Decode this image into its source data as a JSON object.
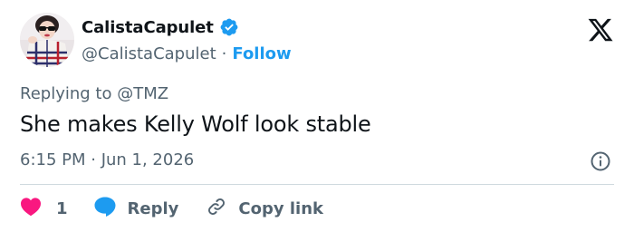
{
  "author": {
    "display_name": "CalistaCapulet",
    "handle": "@CalistaCapulet",
    "separator": "·",
    "follow_label": "Follow"
  },
  "tweet": {
    "replying_to": "Replying to @TMZ",
    "text": "She makes Kelly Wolf look stable",
    "timestamp": "6:15 PM · Jun 1, 2026"
  },
  "actions": {
    "like_count": "1",
    "reply_label": "Reply",
    "copy_link_label": "Copy link"
  },
  "icons": {
    "verified": "verified-badge-icon",
    "logo": "x-logo-icon",
    "info": "info-icon",
    "like": "heart-icon",
    "reply": "speech-bubble-icon",
    "copy": "link-icon"
  },
  "colors": {
    "accent": "#1d9bf0",
    "like": "#f91880",
    "text": "#0f1419",
    "secondary": "#536471",
    "divider": "#cfd9de"
  }
}
